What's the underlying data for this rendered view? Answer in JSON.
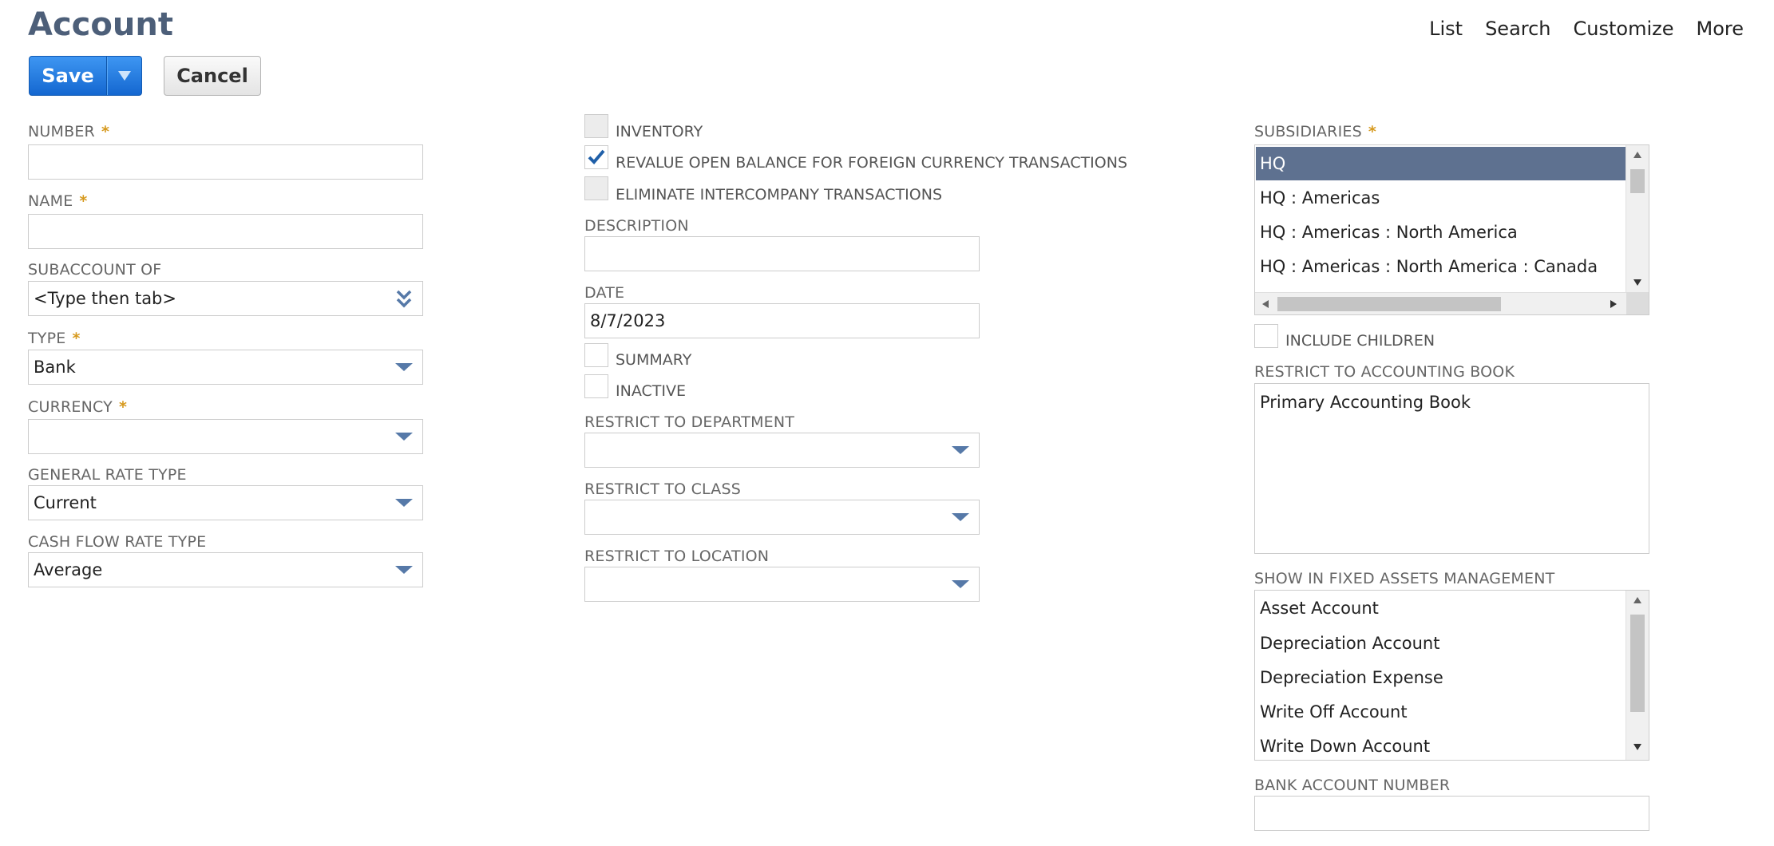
{
  "header": {
    "title": "Account",
    "links": [
      "List",
      "Search",
      "Customize",
      "More"
    ]
  },
  "toolbar": {
    "save_label": "Save",
    "cancel_label": "Cancel"
  },
  "left": {
    "number": {
      "label": "NUMBER",
      "value": ""
    },
    "name": {
      "label": "NAME",
      "value": ""
    },
    "subaccount": {
      "label": "SUBACCOUNT OF",
      "value": "<Type then tab>"
    },
    "type": {
      "label": "TYPE",
      "value": "Bank"
    },
    "currency": {
      "label": "CURRENCY",
      "value": ""
    },
    "general_rate": {
      "label": "GENERAL RATE TYPE",
      "value": "Current"
    },
    "cash_flow_rate": {
      "label": "CASH FLOW RATE TYPE",
      "value": "Average"
    },
    "required_mark": "*"
  },
  "middle": {
    "inventory": {
      "label": "INVENTORY",
      "checked": false
    },
    "revalue": {
      "label": "REVALUE OPEN BALANCE FOR FOREIGN CURRENCY TRANSACTIONS",
      "checked": true
    },
    "eliminate": {
      "label": "ELIMINATE INTERCOMPANY TRANSACTIONS",
      "checked": false
    },
    "description": {
      "label": "DESCRIPTION",
      "value": ""
    },
    "date": {
      "label": "DATE",
      "value": "8/7/2023"
    },
    "summary": {
      "label": "SUMMARY",
      "checked": false
    },
    "inactive": {
      "label": "INACTIVE",
      "checked": false
    },
    "department": {
      "label": "RESTRICT TO DEPARTMENT",
      "value": ""
    },
    "class": {
      "label": "RESTRICT TO CLASS",
      "value": ""
    },
    "location": {
      "label": "RESTRICT TO LOCATION",
      "value": ""
    }
  },
  "right": {
    "subsidiaries": {
      "label": "SUBSIDIARIES",
      "items": [
        "HQ",
        "HQ : Americas",
        "HQ : Americas : North America",
        "HQ : Americas : North America : Canada"
      ],
      "selected_index": 0
    },
    "include_children": {
      "label": "INCLUDE CHILDREN",
      "checked": false
    },
    "accounting_book": {
      "label": "RESTRICT TO ACCOUNTING BOOK",
      "items": [
        "Primary Accounting Book"
      ]
    },
    "fixed_assets": {
      "label": "SHOW IN FIXED ASSETS MANAGEMENT",
      "items": [
        "Asset Account",
        "Depreciation Account",
        "Depreciation Expense",
        "Write Off Account",
        "Write Down Account"
      ]
    },
    "bank_account_number": {
      "label": "BANK ACCOUNT NUMBER",
      "value": ""
    }
  },
  "colors": {
    "title": "#4d5f79",
    "save_button": "#1f7ae0",
    "selected_row": "#5e7190",
    "required": "#d6991d",
    "dropdown_arrow": "#5679a8"
  }
}
